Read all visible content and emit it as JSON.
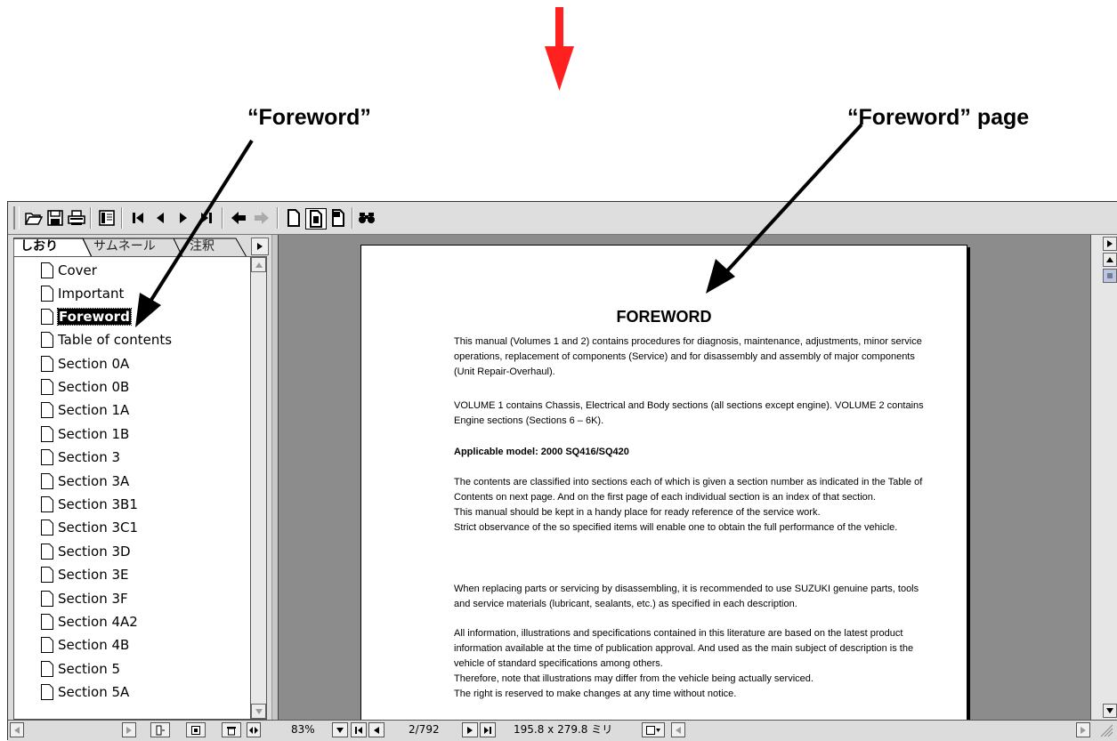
{
  "callouts": {
    "foreword_label": "“Foreword”",
    "page_label": "“Foreword” page"
  },
  "toolbar": {
    "buttons": [
      "open-icon",
      "save-icon",
      "print-icon",
      "show-hide-navigation-icon",
      "first-page-icon",
      "previous-page-icon",
      "next-page-icon",
      "last-page-icon",
      "go-back-icon",
      "go-forward-icon",
      "actual-size-icon",
      "fit-page-icon",
      "fit-width-icon",
      "find-icon"
    ]
  },
  "navigation": {
    "tabs": [
      "しおり",
      "サムネール",
      "注釈"
    ],
    "active_tab": "しおり",
    "bookmarks": [
      "Cover",
      "Important",
      "Foreword",
      "Table of contents",
      "Section 0A",
      "Section 0B",
      "Section 1A",
      "Section 1B",
      "Section 3",
      "Section 3A",
      "Section 3B1",
      "Section 3C1",
      "Section 3D",
      "Section 3E",
      "Section 3F",
      "Section 4A2",
      "Section 4B",
      "Section 5",
      "Section 5A"
    ],
    "selected_bookmark": "Foreword"
  },
  "document": {
    "title": "FOREWORD",
    "paragraphs": [
      "This manual (Volumes 1 and 2) contains procedures for diagnosis, maintenance, adjustments, minor service operations, replacement of components (Service) and for disassembly and assembly of major components (Unit Repair-Overhaul).",
      "VOLUME 1 contains Chassis, Electrical and Body sections (all sections except engine). VOLUME 2 contains Engine sections (Sections 6 – 6K).",
      "Applicable model: 2000 SQ416/SQ420",
      "The contents are classified into sections each of which is given a section number as indicated in the Table of Contents on next page. And on the first page of each individual section is an index of that section.\nThis manual should be kept in a handy place for ready reference of the service work.\nStrict observance of the so specified items will enable one to obtain the full performance of the vehicle.",
      "When replacing parts or servicing by disassembling, it is recommended to use SUZUKI genuine parts, tools and service materials (lubricant, sealants, etc.) as specified in each description.",
      "All information, illustrations and specifications contained in this literature are based on the latest product information available at the time of publication approval. And used as the main subject of description is the vehicle of standard specifications among others.\nTherefore, note that illustrations may differ from the vehicle being actually serviced.\nThe right is reserved to make changes at any time without notice."
    ]
  },
  "statusbar": {
    "zoom": "83%",
    "page_indicator": "2/792",
    "page_size": "195.8 x 279.8 ミリ"
  }
}
